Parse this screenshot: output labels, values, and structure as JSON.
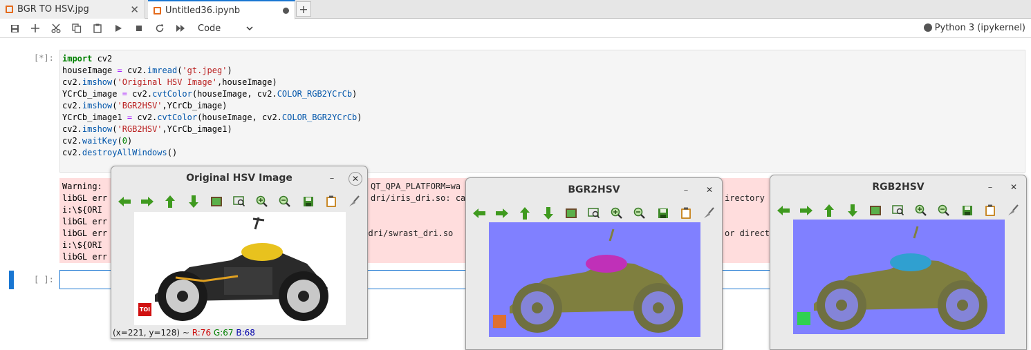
{
  "tabs": [
    {
      "label": "BGR TO HSV.jpg"
    },
    {
      "label": "Untitled36.ipynb"
    }
  ],
  "toolbar": {
    "cell_type": "Code",
    "kernel": "Python 3 (ipykernel)"
  },
  "cells": {
    "code_prompt": "[*]:",
    "empty_prompt": "[ ]:",
    "output_lines": [
      "Warning: ",
      "libGL err",
      "i:\\${ORI",
      "libGL err",
      "libGL err",
      "i:\\${ORI",
      "libGL err"
    ],
    "output_right": {
      "a": "QT_QPA_PLATFORM=wa",
      "b": "dri/iris_dri.so: ca",
      "c": "irectory",
      "d": "b/dri/swrast_dri.so",
      "e": "or direct"
    }
  },
  "windows": {
    "w1": {
      "title": "Original HSV Image",
      "status_prefix": "(x=221, y=128) ~ ",
      "r": "R:76",
      "g": "G:67",
      "b": "B:68",
      "logo": "TOI"
    },
    "w2": {
      "title": "BGR2HSV"
    },
    "w3": {
      "title": "RGB2HSV"
    }
  },
  "colors": {
    "accent": "#1976d2",
    "error_bg": "#ffdddd",
    "hsv_bg": "#8080ff",
    "olive": "#7f7f3f",
    "magenta": "#c030b8",
    "cyan": "#30a0d0"
  }
}
